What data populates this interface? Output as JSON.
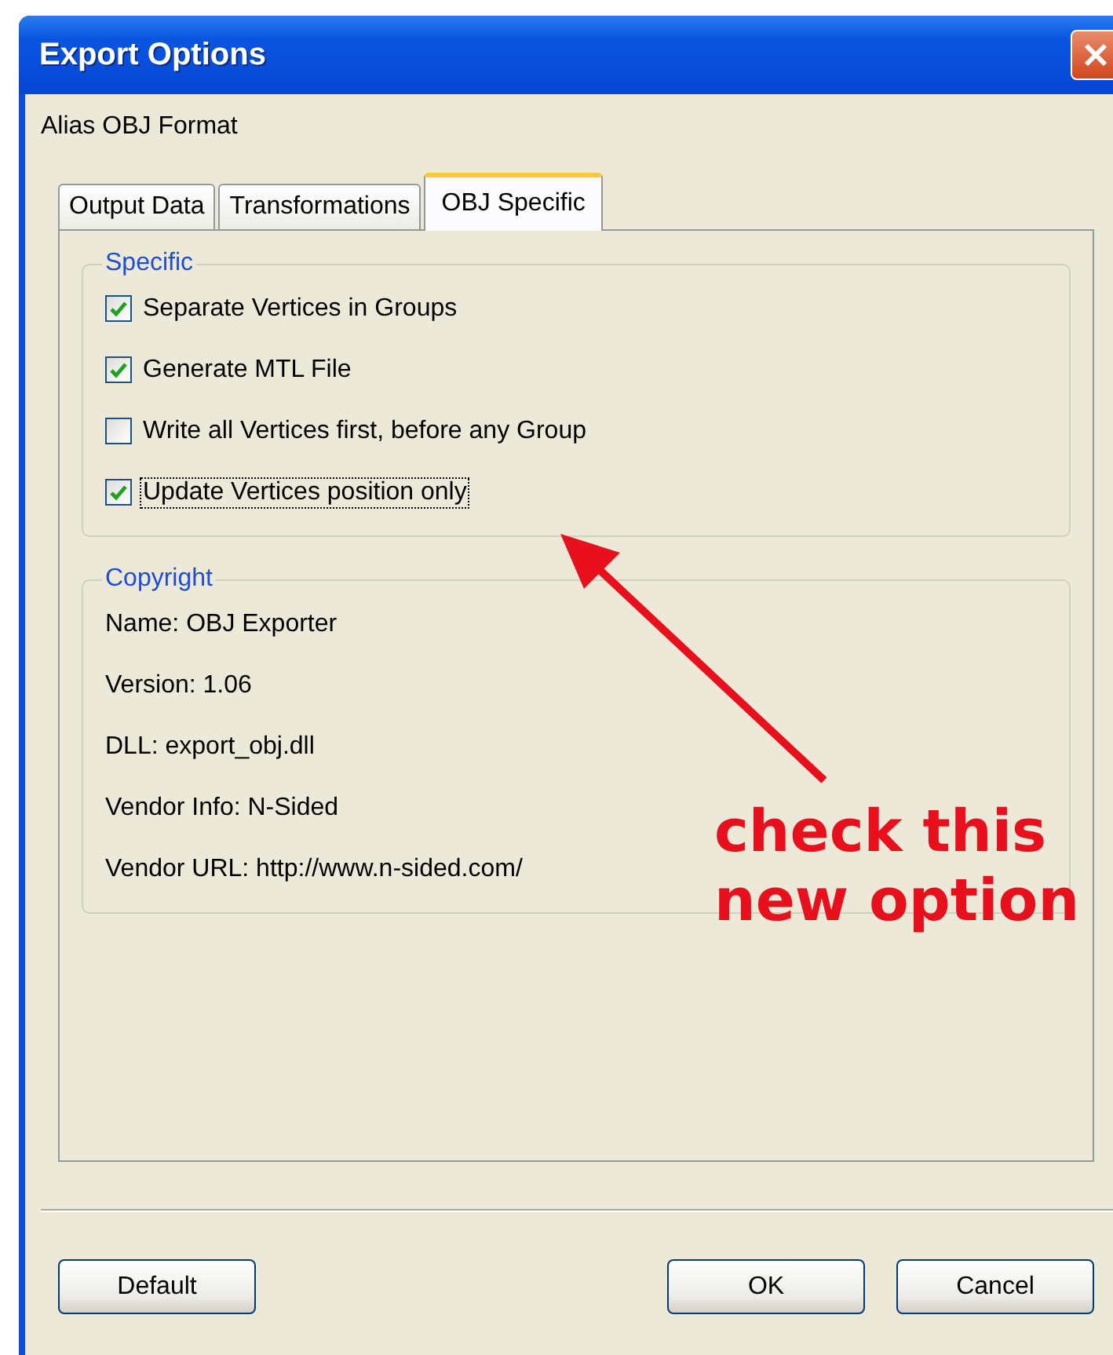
{
  "window": {
    "title": "Export Options"
  },
  "subtitle": "Alias OBJ Format",
  "tabs": [
    {
      "label": "Output Data",
      "selected": false
    },
    {
      "label": "Transformations",
      "selected": false
    },
    {
      "label": "OBJ Specific",
      "selected": true
    }
  ],
  "specific": {
    "title": "Specific",
    "options": [
      {
        "label": "Separate Vertices in Groups",
        "checked": true,
        "focused": false
      },
      {
        "label": "Generate MTL File",
        "checked": true,
        "focused": false
      },
      {
        "label": "Write all Vertices first, before any Group",
        "checked": false,
        "focused": false
      },
      {
        "label": "Update Vertices position only",
        "checked": true,
        "focused": true
      }
    ]
  },
  "copyright": {
    "title": "Copyright",
    "lines": [
      "Name: OBJ Exporter",
      "Version: 1.06",
      "DLL: export_obj.dll",
      "Vendor Info: N-Sided",
      "Vendor URL: http://www.n-sided.com/"
    ]
  },
  "buttons": [
    {
      "label": "Default",
      "kind": "left"
    },
    {
      "label": "OK",
      "kind": "right"
    },
    {
      "label": "Cancel",
      "kind": "right"
    }
  ],
  "annotation": {
    "text": "check this new option"
  }
}
